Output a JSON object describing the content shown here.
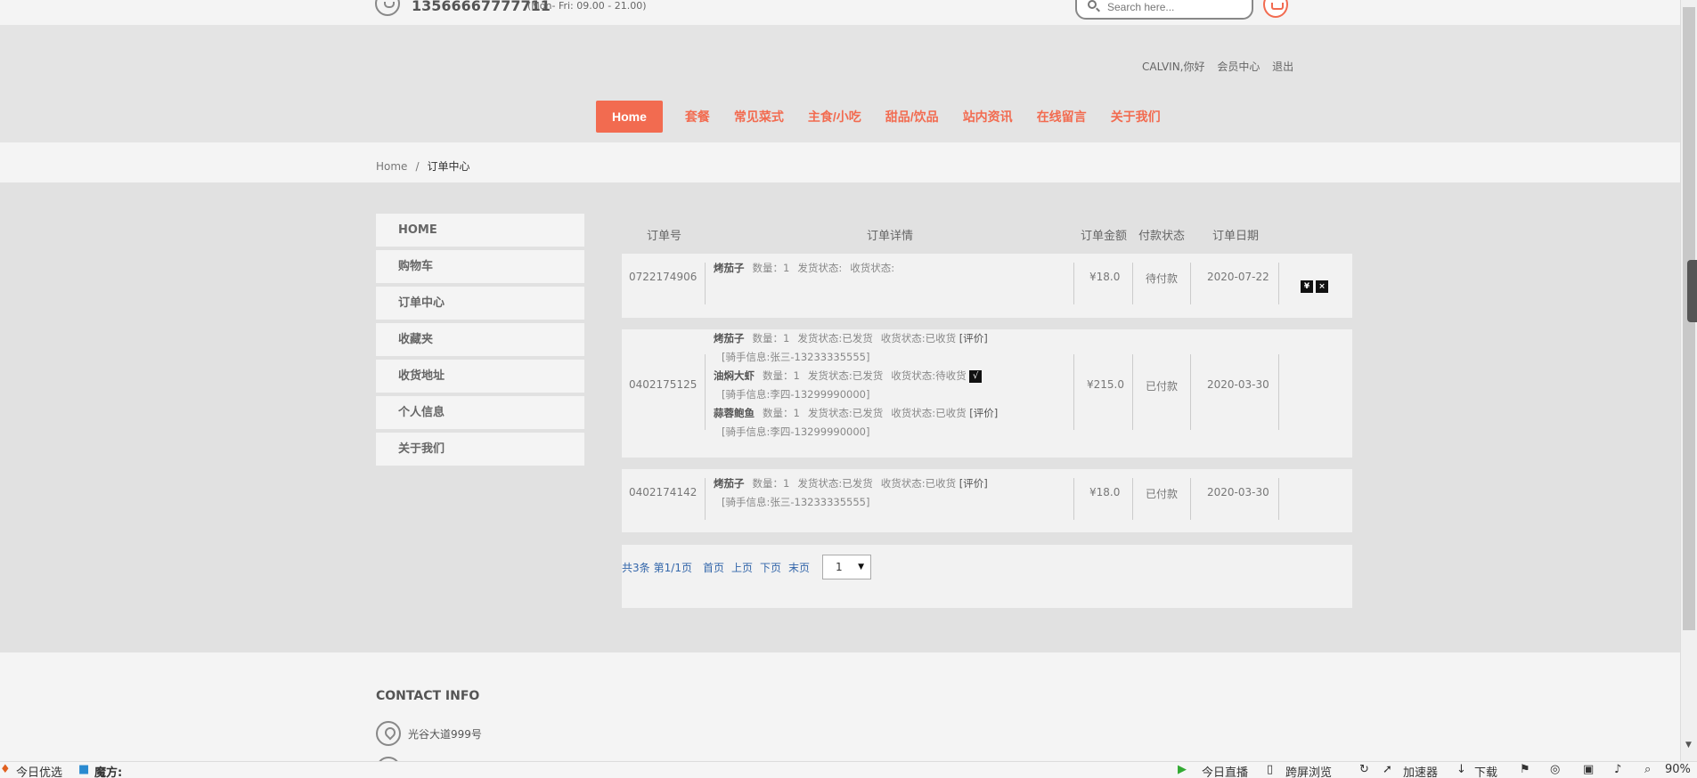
{
  "topbar": {
    "phone": "13566667777711",
    "hours": "(Mon- Fri: 09.00 - 21.00)",
    "search_placeholder": "Search here..."
  },
  "userbar": {
    "greeting": "CALVIN,你好",
    "member_center": "会员中心",
    "logout": "退出"
  },
  "nav": [
    "Home",
    "套餐",
    "常见菜式",
    "主食/小吃",
    "甜品/饮品",
    "站内资讯",
    "在线留言",
    "关于我们"
  ],
  "breadcrumb": {
    "home": "Home",
    "sep": "/",
    "current": "订单中心"
  },
  "sidemenu": [
    "HOME",
    "购物车",
    "订单中心",
    "收藏夹",
    "收货地址",
    "个人信息",
    "关于我们"
  ],
  "table_headers": {
    "order_no": "订单号",
    "details": "订单详情",
    "amount": "订单金额",
    "pay_status": "付款状态",
    "date": "订单日期"
  },
  "orders": [
    {
      "id": "0722174906",
      "amount": "¥18.0",
      "pay_status": "待付款",
      "date": "2020-07-22",
      "items": [
        {
          "name": "烤茄子",
          "qty": "数量：1",
          "ship": "发货状态:",
          "recv": "收货状态:",
          "action": "",
          "rider": ""
        }
      ],
      "ops": [
        "¥",
        "×"
      ]
    },
    {
      "id": "0402175125",
      "amount": "¥215.0",
      "pay_status": "已付款",
      "date": "2020-03-30",
      "items": [
        {
          "name": "烤茄子",
          "qty": "数量：1",
          "ship": "发货状态:已发货",
          "recv": "收货状态:已收货",
          "action": "[评价]",
          "rider": "[骑手信息:张三-13233335555]"
        },
        {
          "name": "油焖大虾",
          "qty": "数量：1",
          "ship": "发货状态:已发货",
          "recv": "收货状态:待收货",
          "action": "√",
          "rider": "[骑手信息:李四-13299990000]"
        },
        {
          "name": "蒜蓉鲍鱼",
          "qty": "数量：1",
          "ship": "发货状态:已发货",
          "recv": "收货状态:已收货",
          "action": "[评价]",
          "rider": "[骑手信息:李四-13299990000]"
        }
      ],
      "ops": []
    },
    {
      "id": "0402174142",
      "amount": "¥18.0",
      "pay_status": "已付款",
      "date": "2020-03-30",
      "items": [
        {
          "name": "烤茄子",
          "qty": "数量：1",
          "ship": "发货状态:已发货",
          "recv": "收货状态:已收货",
          "action": "[评价]",
          "rider": "[骑手信息:张三-13233335555]"
        }
      ],
      "ops": []
    }
  ],
  "pager": {
    "total": "共3条",
    "page_info": "第1/1页",
    "first": "首页",
    "prev": "上页",
    "next": "下页",
    "last": "末页",
    "current": "1"
  },
  "footer": {
    "contact_title": "CONTACT INFO",
    "address": "光谷大道999号"
  },
  "statusbar": {
    "left1": "今日优选",
    "left2": "魔方:",
    "live": "今日直播",
    "cross": "跨屏浏览",
    "accel": "加速器",
    "download": "下载",
    "zoom": "90%"
  },
  "colors": {
    "accent": "#f26b50",
    "link": "#3366aa"
  }
}
